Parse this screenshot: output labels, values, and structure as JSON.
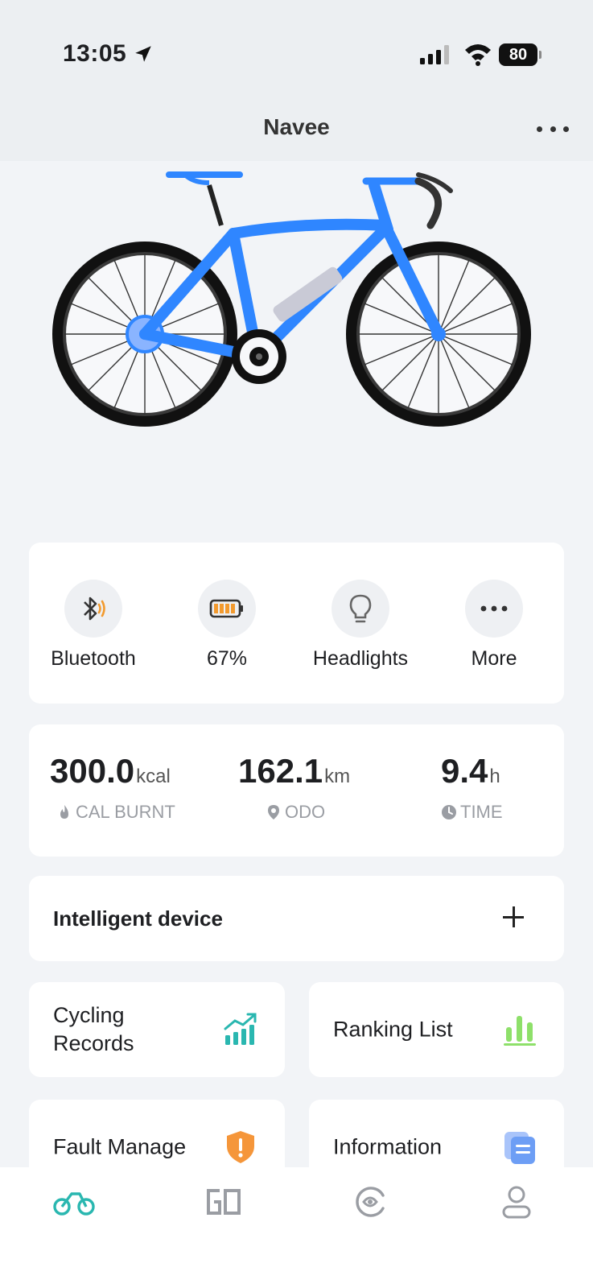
{
  "status_bar": {
    "time": "13:05",
    "battery": "80"
  },
  "header": {
    "title": "Navee"
  },
  "quick_actions": [
    {
      "label": "Bluetooth",
      "icon": "bluetooth-icon"
    },
    {
      "label": "67%",
      "icon": "battery-icon"
    },
    {
      "label": "Headlights",
      "icon": "lightbulb-icon"
    },
    {
      "label": "More",
      "icon": "more-dots-icon"
    }
  ],
  "stats": [
    {
      "value": "300.0",
      "unit": "kcal",
      "label": "CAL BURNT",
      "icon": "flame-icon"
    },
    {
      "value": "162.1",
      "unit": "km",
      "label": "ODO",
      "icon": "location-pin-icon"
    },
    {
      "value": "9.4",
      "unit": "h",
      "label": "TIME",
      "icon": "clock-icon"
    }
  ],
  "intelligent_device": {
    "title": "Intelligent device"
  },
  "tiles": {
    "cycling_records": {
      "line1": "Cycling",
      "line2": "Records"
    },
    "ranking_list": {
      "label": "Ranking List"
    },
    "fault_manage": {
      "label": "Fault Manage"
    },
    "information": {
      "label": "Information"
    }
  },
  "colors": {
    "accent_teal": "#2ab7b0",
    "bike_blue": "#2f86ff",
    "bluetooth_orange": "#f29a2e",
    "ranking_green": "#8ee06a",
    "fault_orange": "#f5963a",
    "info_blue": "#6d9ef5"
  },
  "bottom_nav": [
    {
      "icon": "bike-nav-icon",
      "active": true
    },
    {
      "icon": "go-nav-icon",
      "active": false
    },
    {
      "icon": "discover-nav-icon",
      "active": false
    },
    {
      "icon": "profile-nav-icon",
      "active": false
    }
  ]
}
